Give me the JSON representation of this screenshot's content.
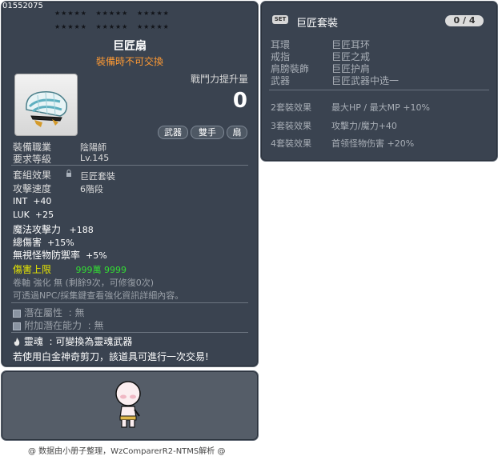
{
  "item": {
    "id": "01552075",
    "name": "巨匠扇",
    "trade_note": "裝備時不可交換",
    "power_label": "戰鬥力提升量",
    "power_value": "0",
    "tags": [
      "武器",
      "雙手",
      "扇"
    ],
    "job_label": "裝備職業",
    "job_value": "陰陽師",
    "level_label": "要求等級",
    "level_value": "Lv.145",
    "set_effect_label": "套組效果",
    "set_effect_value": "巨匠套裝",
    "speed_label": "攻擊速度",
    "speed_value": "6階段",
    "stats": [
      {
        "label": "INT",
        "value": "+40"
      },
      {
        "label": "LUK",
        "value": "+25"
      },
      {
        "label": "魔法攻擊力",
        "value": "+188"
      },
      {
        "label": "總傷害",
        "value": "+15%"
      },
      {
        "label": "無視怪物防禦率",
        "value": "+5%"
      }
    ],
    "damage_cap_label": "傷害上限",
    "damage_cap_value": "999萬 9999",
    "scroll_line": "卷軸 強化 無 (剩餘9次，可修復0次)",
    "enhance_line": "可透過NPC/採集鍵查看強化資訊詳細內容。",
    "potential_label": "潛在屬性",
    "potential_value": ": 無",
    "add_potential_label": "附加潛在能力",
    "add_potential_value": ": 無",
    "soul_label": "靈魂",
    "soul_value": ": 可變換為靈魂武器",
    "scissors_line": "若使用白金神奇剪刀，該道具可進行一次交易!"
  },
  "set": {
    "badge": "SET",
    "name": "巨匠套裝",
    "count": "0 / 4",
    "parts": [
      {
        "slot": "耳環",
        "name": "巨匠耳环"
      },
      {
        "slot": "戒指",
        "name": "巨匠之戒"
      },
      {
        "slot": "肩膀裝飾",
        "name": "巨匠护肩"
      },
      {
        "slot": "武器",
        "name": "巨匠武器中选一"
      }
    ],
    "effects": [
      {
        "tier": "2套裝效果",
        "desc": "最大HP / 最大MP  +10%"
      },
      {
        "tier": "3套裝效果",
        "desc": "攻擊力/魔力+40"
      },
      {
        "tier": "4套裝效果",
        "desc": "首领怪物伤害 +20%"
      }
    ]
  },
  "footer": "@ 数据由小册子整理，WzComparerR2-NTMS解析 @",
  "colors": {
    "panel_bg": "#3a4350",
    "title": "#ffffff",
    "trade_note": "#ff9a33",
    "damage_cap": "#e6e600",
    "damage_cap_value": "#33dd33",
    "muted": "#9aa0a8"
  },
  "icons": [
    "fan-item-icon",
    "lock-icon",
    "potential-box-icon",
    "flame-icon",
    "character-avatar"
  ]
}
